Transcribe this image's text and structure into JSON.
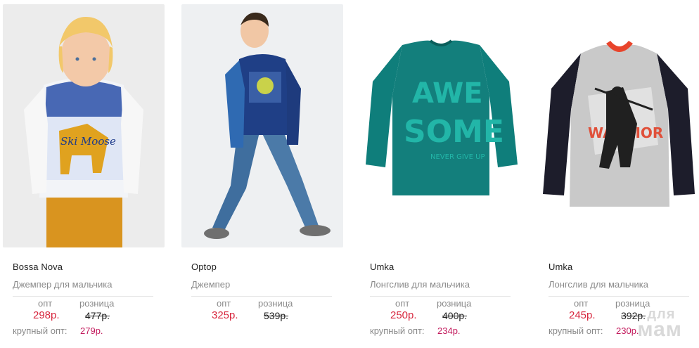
{
  "products": [
    {
      "brand": "Bossa Nova",
      "description": "Джемпер для мальчика",
      "opt_label": "опт",
      "opt_price": "298р.",
      "retail_label": "розница",
      "retail_price": "477р.",
      "bulk_label": "крупный опт:",
      "bulk_price": "279р."
    },
    {
      "brand": "Optop",
      "description": "Джемпер",
      "opt_label": "опт",
      "opt_price": "325р.",
      "retail_label": "розница",
      "retail_price": "539р.",
      "bulk_label": "",
      "bulk_price": ""
    },
    {
      "brand": "Umka",
      "description": "Лонгслив для мальчика",
      "opt_label": "опт",
      "opt_price": "250р.",
      "retail_label": "розница",
      "retail_price": "400р.",
      "bulk_label": "крупный опт:",
      "bulk_price": "234р."
    },
    {
      "brand": "Umka",
      "description": "Лонгслив для мальчика",
      "opt_label": "опт",
      "opt_price": "245р.",
      "retail_label": "розница",
      "retail_price": "392р.",
      "bulk_label": "крупный опт:",
      "bulk_price": "230р."
    }
  ],
  "photo_text": {
    "p1_print": "Ski Moose",
    "p3_print_line1": "AWE",
    "p3_print_line2": "SOME",
    "p3_print_line3": "NEVER GIVE UP",
    "p4_print": "WARRIOR"
  },
  "watermark": {
    "line1": "для",
    "line2": "мам"
  },
  "colors": {
    "price_red": "#d7263d",
    "bulk_pink": "#c2185b",
    "teal_shirt": "#0f7e7b"
  }
}
